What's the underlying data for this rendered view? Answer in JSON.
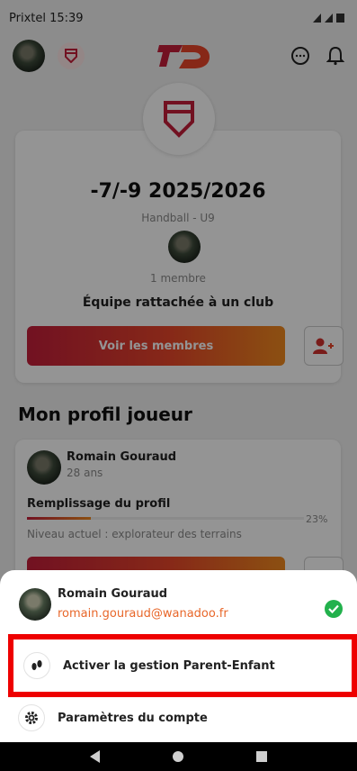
{
  "status_bar": {
    "carrier": "Prixtel",
    "time": "15:39"
  },
  "team": {
    "name": "-7/-9 2025/2026",
    "sport_category": "Handball - U9",
    "member_count": "1 membre",
    "club_status": "Équipe rattachée à un club",
    "view_members_label": "Voir les membres"
  },
  "profile_section": {
    "title": "Mon profil joueur",
    "name": "Romain Gouraud",
    "age": "28 ans",
    "fill_label": "Remplissage du profil",
    "fill_percent": "23%",
    "fill_fraction": 0.23,
    "level": "Niveau actuel : explorateur des terrains"
  },
  "account_sheet": {
    "name": "Romain Gouraud",
    "email": "romain.gouraud@wanadoo.fr",
    "parent_child_label": "Activer la gestion Parent-Enfant",
    "settings_label": "Paramètres du compte"
  },
  "colors": {
    "brand_red": "#c41e3a",
    "brand_orange": "#f08a1e",
    "email": "#e8672a",
    "verified": "#22b14c",
    "highlight": "#ee0000"
  },
  "icons": {
    "status": [
      "wifi-icon",
      "signal-icon",
      "battery-icon"
    ],
    "top_bar": [
      "chat-icon",
      "bell-icon"
    ],
    "parent_child": "footprints-icon",
    "settings": "gear-icon",
    "verified": "check-icon"
  }
}
